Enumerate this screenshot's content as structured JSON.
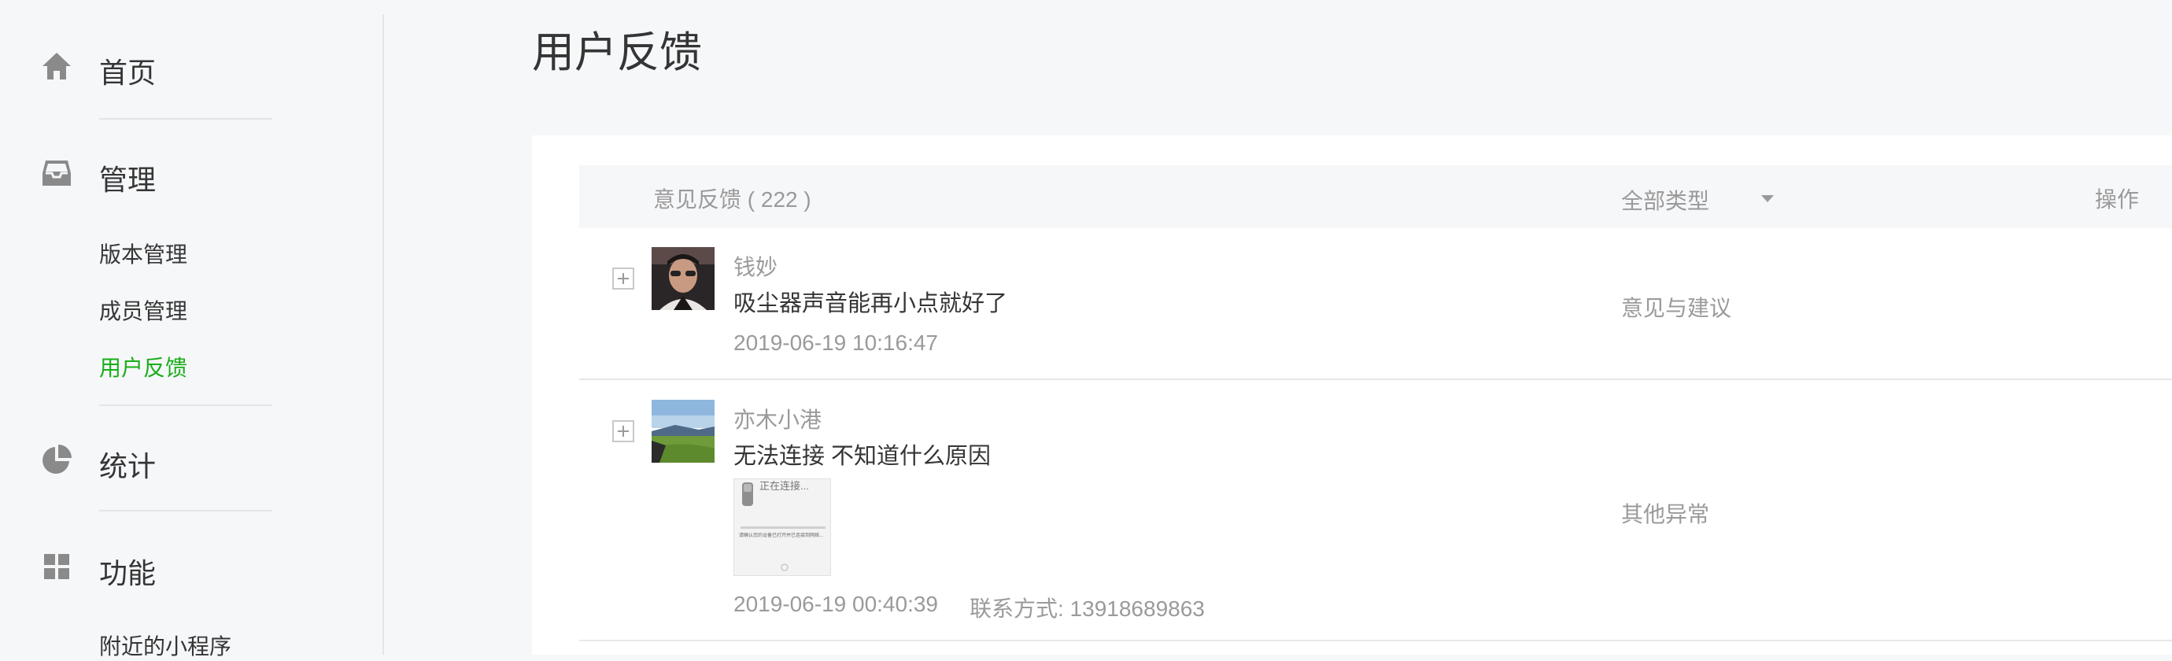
{
  "sidebar": {
    "groups": [
      {
        "label": "首页",
        "icon": "home-icon"
      },
      {
        "label": "管理",
        "icon": "inbox-icon"
      },
      {
        "label": "统计",
        "icon": "pie-chart-icon"
      },
      {
        "label": "功能",
        "icon": "grid-icon"
      }
    ],
    "manage_items": [
      {
        "label": "版本管理",
        "active": false
      },
      {
        "label": "成员管理",
        "active": false
      },
      {
        "label": "用户反馈",
        "active": true
      }
    ],
    "feature_items": [
      {
        "label": "附近的小程序"
      }
    ]
  },
  "page": {
    "title": "用户反馈"
  },
  "table": {
    "header": {
      "feedback": "意见反馈 ( 222 )",
      "type_filter": "全部类型",
      "operation": "操作"
    },
    "rows": [
      {
        "user": "钱妙",
        "content": "吸尘器声音能再小点就好了",
        "time": "2019-06-19 10:16:47",
        "type": "意见与建议"
      },
      {
        "user": "亦木小港",
        "content": "无法连接 不知道什么原因",
        "thumbnail_text": "正在连接...",
        "thumbnail_caption": "请确认您的设备已打开并已连接到网络...",
        "time": "2019-06-19 00:40:39",
        "contact": "联系方式: 13918689863",
        "type": "其他异常"
      }
    ]
  },
  "colors": {
    "accent": "#1aad19",
    "background": "#f6f7f9",
    "text": "#353535",
    "muted": "#9a9a9a"
  }
}
